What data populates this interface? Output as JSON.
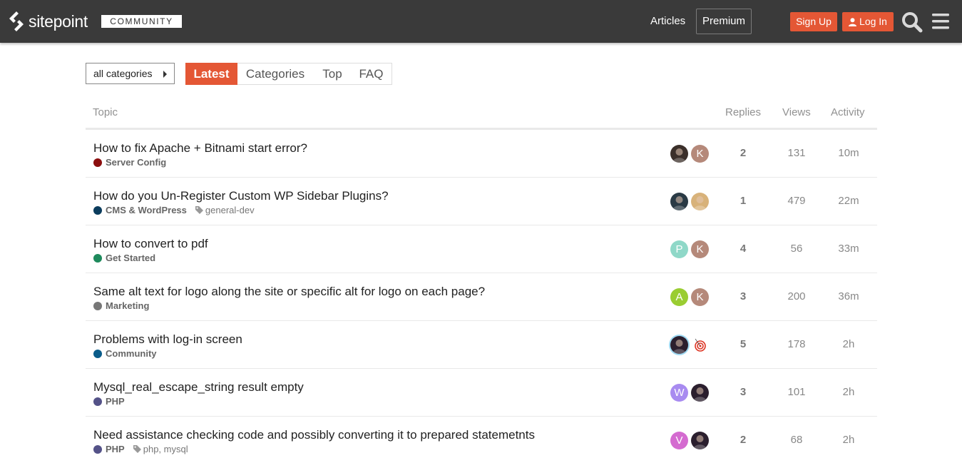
{
  "header": {
    "brand": "sitepoint",
    "community_badge": "COMMUNITY",
    "articles_label": "Articles",
    "premium_label": "Premium",
    "signup_label": "Sign Up",
    "login_label": "Log In",
    "accent_color": "#e45735",
    "bar_color": "#3a3a3a",
    "icons": [
      "sitepoint-logo-icon",
      "user-icon",
      "search-icon",
      "hamburger-menu-icon"
    ]
  },
  "filters": {
    "category_select": "all categories",
    "tabs": [
      {
        "label": "Latest",
        "active": true
      },
      {
        "label": "Categories",
        "active": false
      },
      {
        "label": "Top",
        "active": false
      },
      {
        "label": "FAQ",
        "active": false
      }
    ]
  },
  "table": {
    "columns": {
      "topic": "Topic",
      "replies": "Replies",
      "views": "Views",
      "activity": "Activity"
    },
    "topics": [
      {
        "title": "How to fix Apache + Bitnami start error?",
        "category": "Server Config",
        "category_color": "#8b0e0e",
        "tags": "",
        "avatars": [
          {
            "letter": "",
            "color": "#3b2f2a",
            "kind": "photo"
          },
          {
            "letter": "K",
            "color": "#b5897a",
            "kind": "letter"
          }
        ],
        "replies": "2",
        "views": "131",
        "activity": "10m"
      },
      {
        "title": "How do you Un-Register Custom WP Sidebar Plugins?",
        "category": "CMS & WordPress",
        "category_color": "#0b3c5d",
        "tags": "general-dev",
        "avatars": [
          {
            "letter": "",
            "color": "#2a3a45",
            "kind": "photo"
          },
          {
            "letter": "",
            "color": "#d8b27a",
            "kind": "photo"
          }
        ],
        "replies": "1",
        "views": "479",
        "activity": "22m"
      },
      {
        "title": "How to convert to pdf",
        "category": "Get Started",
        "category_color": "#1e8a5c",
        "tags": "",
        "avatars": [
          {
            "letter": "P",
            "color": "#8fd8c8",
            "kind": "letter"
          },
          {
            "letter": "K",
            "color": "#b5897a",
            "kind": "letter"
          }
        ],
        "replies": "4",
        "views": "56",
        "activity": "33m"
      },
      {
        "title": "Same alt text for logo along the site or specific alt for logo on each page?",
        "category": "Marketing",
        "category_color": "#777777",
        "tags": "",
        "avatars": [
          {
            "letter": "A",
            "color": "#9acd32",
            "kind": "letter"
          },
          {
            "letter": "K",
            "color": "#b5897a",
            "kind": "letter"
          }
        ],
        "replies": "3",
        "views": "200",
        "activity": "36m"
      },
      {
        "title": "Problems with log-in screen",
        "category": "Community",
        "category_color": "#0a5c8a",
        "tags": "",
        "avatars": [
          {
            "letter": "",
            "color": "#2b1f2e",
            "kind": "photo"
          },
          {
            "letter": "",
            "color": "#ffffff",
            "kind": "target"
          }
        ],
        "replies": "5",
        "views": "178",
        "activity": "2h"
      },
      {
        "title": "Mysql_real_escape_string result empty",
        "category": "PHP",
        "category_color": "#545288",
        "tags": "",
        "avatars": [
          {
            "letter": "W",
            "color": "#a88bf0",
            "kind": "letter"
          },
          {
            "letter": "",
            "color": "#2b1f2e",
            "kind": "photo"
          }
        ],
        "replies": "3",
        "views": "101",
        "activity": "2h"
      },
      {
        "title": "Need assistance checking code and possibly converting it to prepared statemetnts",
        "category": "PHP",
        "category_color": "#545288",
        "tags": "php, mysql",
        "avatars": [
          {
            "letter": "V",
            "color": "#d46bd0",
            "kind": "letter"
          },
          {
            "letter": "",
            "color": "#2b1f2e",
            "kind": "photo"
          }
        ],
        "replies": "2",
        "views": "68",
        "activity": "2h"
      }
    ]
  }
}
